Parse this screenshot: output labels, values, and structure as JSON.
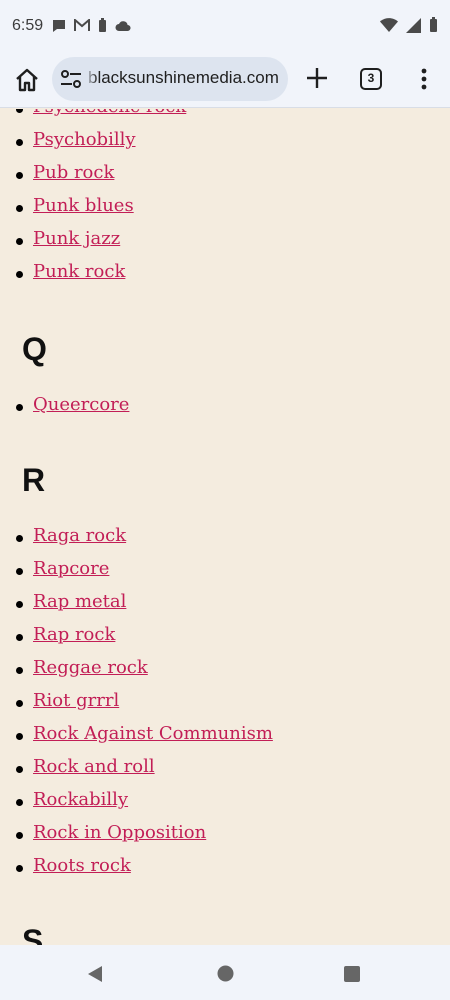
{
  "status": {
    "time": "6:59"
  },
  "browser": {
    "url": "blacksunshinemedia.com",
    "tab_count": "3"
  },
  "page": {
    "sections": [
      {
        "letter": "",
        "items": [
          "Psychedelic rock",
          "Psychobilly",
          "Pub rock",
          "Punk blues",
          "Punk jazz",
          "Punk rock"
        ]
      },
      {
        "letter": "Q",
        "items": [
          "Queercore"
        ]
      },
      {
        "letter": "R",
        "items": [
          "Raga rock",
          "Rapcore",
          "Rap metal",
          "Rap rock",
          "Reggae rock",
          "Riot grrrl",
          "Rock Against Communism",
          "Rock and roll",
          "Rockabilly",
          "Rock in Opposition",
          "Roots rock"
        ]
      },
      {
        "letter": "S",
        "items": []
      }
    ]
  },
  "colors": {
    "link": "#c21e56",
    "page_bg": "#f4ecdf",
    "chrome_bg": "#f1f4fa"
  },
  "icons": [
    "chat-icon",
    "gmail-icon",
    "battery-icon",
    "cloud-icon",
    "wifi-icon",
    "signal-icon",
    "home-icon",
    "site-info-icon",
    "plus-icon",
    "tabs-icon",
    "more-vert-icon",
    "back-icon",
    "home-circle-icon",
    "recents-icon"
  ]
}
